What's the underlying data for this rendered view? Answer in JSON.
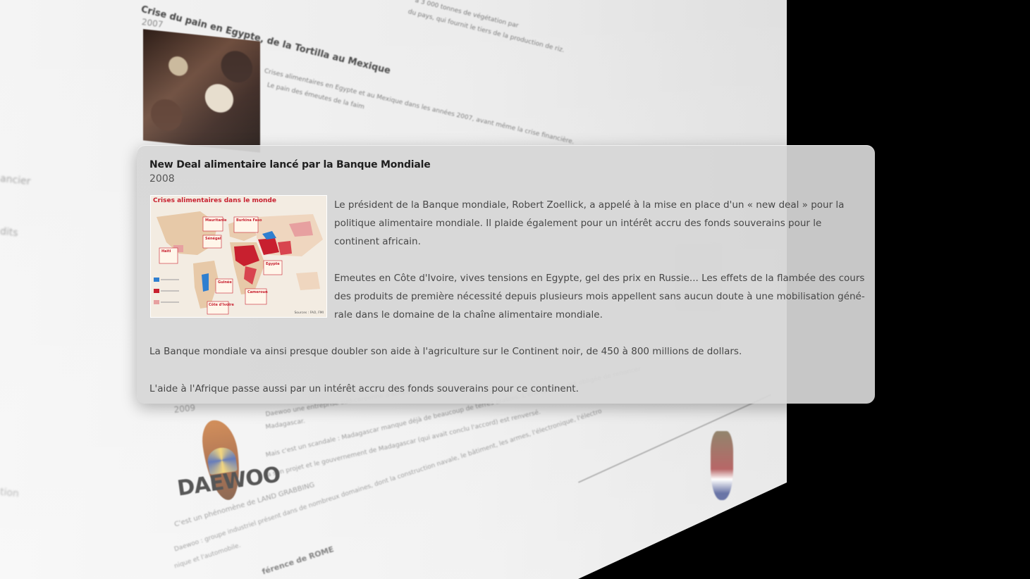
{
  "background_page": {
    "sidebar_fragments": [
      "ancier",
      "dits",
      "tion"
    ],
    "entries": [
      {
        "title": "Crise du pain en Egypte, de la Tortilla au Mexique",
        "year": "2007",
        "text": "Crises alimentaires en Egypte et au Mexique dans les années 2007, avant même la crise financière.",
        "text2": "Le pain des émeutes de la faim"
      },
      {
        "year": "2009",
        "brand": "DAEWOO",
        "text_lines": [
          "Daewoo une entreprise sud-coréenne a acheté",
          "Madagascar.",
          "Mais c'est un scandale : Madagascar manque déjà de beaucoup de terres arables. L'entreprise a été obligée de renoncer",
          "à son projet et le gouvernement de Madagascar (qui avait conclu l'accord) est renversé.",
          "C'est un phénomène de LAND GRABBING",
          "Daewoo : groupe industriel présent dans de nombreux domaines, dont la construction navale, le bâtiment, les armes, l'électronique, l'électro",
          "nique et l'automobile."
        ]
      }
    ],
    "top_right_text": [
      "a 3 000 tonnes de végétation par",
      "du pays, qui fournit le tiers de la production de riz."
    ],
    "bottom_fragment": "férence de ROME"
  },
  "card": {
    "title": "New Deal alimentaire lancé par la Banque Mondiale",
    "year": "2008",
    "map": {
      "title": "Crises alimentaires dans le monde",
      "labels": [
        "Mauritanie",
        "Burkina Faso",
        "Sénégal",
        "Haïti",
        "Guinée",
        "Egypte",
        "Côte d'Ivoire",
        "Cameroun"
      ],
      "source": "Sources : FAO, FMI"
    },
    "paragraphs": [
      "Le président de la Banque mondiale, Robert Zoellick, a appelé à la mise en place d'un « new deal » pour la politique alimentaire mondiale. Il plaide également pour un intérêt accru des fonds souverains pour le continent africain.",
      "Emeutes en Côte d'Ivoire, vives tensions en Egypte, gel des prix en Russie... Les effets de la flambée des cours des produits de première nécessité depuis plusieurs mois appellent sans aucun doute à une mobilisation géné-rale dans le domaine de la chaîne alimentaire mondiale.",
      "La Banque mondiale va ainsi presque doubler son aide à l'agriculture sur le Continent noir, de 450 à 800 millions de dollars.",
      "L'aide à l'Afrique passe aussi par un intérêt accru des fonds souverains pour ce continent."
    ]
  },
  "colors": {
    "card_bg": "#d6d6d6",
    "map_red": "#c8202f",
    "map_blue": "#2f7fd0",
    "text": "#474747"
  }
}
